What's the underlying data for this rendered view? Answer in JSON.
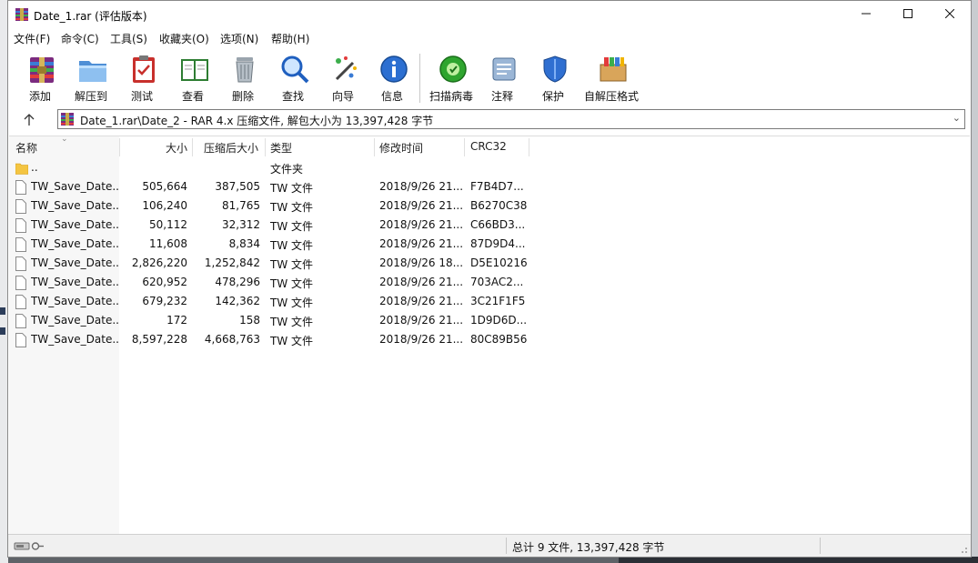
{
  "window": {
    "title": "Date_1.rar (评估版本)"
  },
  "menu": [
    "文件(F)",
    "命令(C)",
    "工具(S)",
    "收藏夹(O)",
    "选项(N)",
    "帮助(H)"
  ],
  "toolbar": [
    {
      "label": "添加",
      "icon": "add-archive-icon"
    },
    {
      "label": "解压到",
      "icon": "extract-folder-icon"
    },
    {
      "label": "测试",
      "icon": "test-clipboard-icon"
    },
    {
      "label": "查看",
      "icon": "view-book-icon"
    },
    {
      "label": "删除",
      "icon": "trash-icon"
    },
    {
      "label": "查找",
      "icon": "magnifier-icon"
    },
    {
      "label": "向导",
      "icon": "wizard-wand-icon"
    },
    {
      "label": "信息",
      "icon": "info-icon"
    },
    {
      "label": "扫描病毒",
      "icon": "virus-scan-icon"
    },
    {
      "label": "注释",
      "icon": "comment-icon"
    },
    {
      "label": "保护",
      "icon": "shield-icon"
    },
    {
      "label": "自解压格式",
      "icon": "sfx-box-icon"
    }
  ],
  "address": {
    "path": "Date_1.rar\\Date_2 - RAR 4.x 压缩文件, 解包大小为 13,397,428 字节"
  },
  "columns": [
    "名称",
    "大小",
    "压缩后大小",
    "类型",
    "修改时间",
    "CRC32"
  ],
  "rows": [
    {
      "name": "..",
      "size": "",
      "packed": "",
      "type": "文件夹",
      "modified": "",
      "crc": "",
      "folder": true
    },
    {
      "name": "TW_Save_Date...",
      "size": "505,664",
      "packed": "387,505",
      "type": "TW 文件",
      "modified": "2018/9/26 21...",
      "crc": "F7B4D7..."
    },
    {
      "name": "TW_Save_Date...",
      "size": "106,240",
      "packed": "81,765",
      "type": "TW 文件",
      "modified": "2018/9/26 21...",
      "crc": "B6270C38"
    },
    {
      "name": "TW_Save_Date...",
      "size": "50,112",
      "packed": "32,312",
      "type": "TW 文件",
      "modified": "2018/9/26 21...",
      "crc": "C66BD3..."
    },
    {
      "name": "TW_Save_Date...",
      "size": "11,608",
      "packed": "8,834",
      "type": "TW 文件",
      "modified": "2018/9/26 21...",
      "crc": "87D9D4..."
    },
    {
      "name": "TW_Save_Date...",
      "size": "2,826,220",
      "packed": "1,252,842",
      "type": "TW 文件",
      "modified": "2018/9/26 18...",
      "crc": "D5E10216"
    },
    {
      "name": "TW_Save_Date...",
      "size": "620,952",
      "packed": "478,296",
      "type": "TW 文件",
      "modified": "2018/9/26 21...",
      "crc": "703AC2..."
    },
    {
      "name": "TW_Save_Date...",
      "size": "679,232",
      "packed": "142,362",
      "type": "TW 文件",
      "modified": "2018/9/26 21...",
      "crc": "3C21F1F5"
    },
    {
      "name": "TW_Save_Date...",
      "size": "172",
      "packed": "158",
      "type": "TW 文件",
      "modified": "2018/9/26 21...",
      "crc": "1D9D6D..."
    },
    {
      "name": "TW_Save_Date...",
      "size": "8,597,228",
      "packed": "4,668,763",
      "type": "TW 文件",
      "modified": "2018/9/26 21...",
      "crc": "80C89B56"
    }
  ],
  "status": {
    "summary": "总计 9 文件, 13,397,428 字节"
  },
  "colors": {
    "accent": "#0a64c8",
    "folder": "#f4c542",
    "selection": "#cce8ff"
  }
}
